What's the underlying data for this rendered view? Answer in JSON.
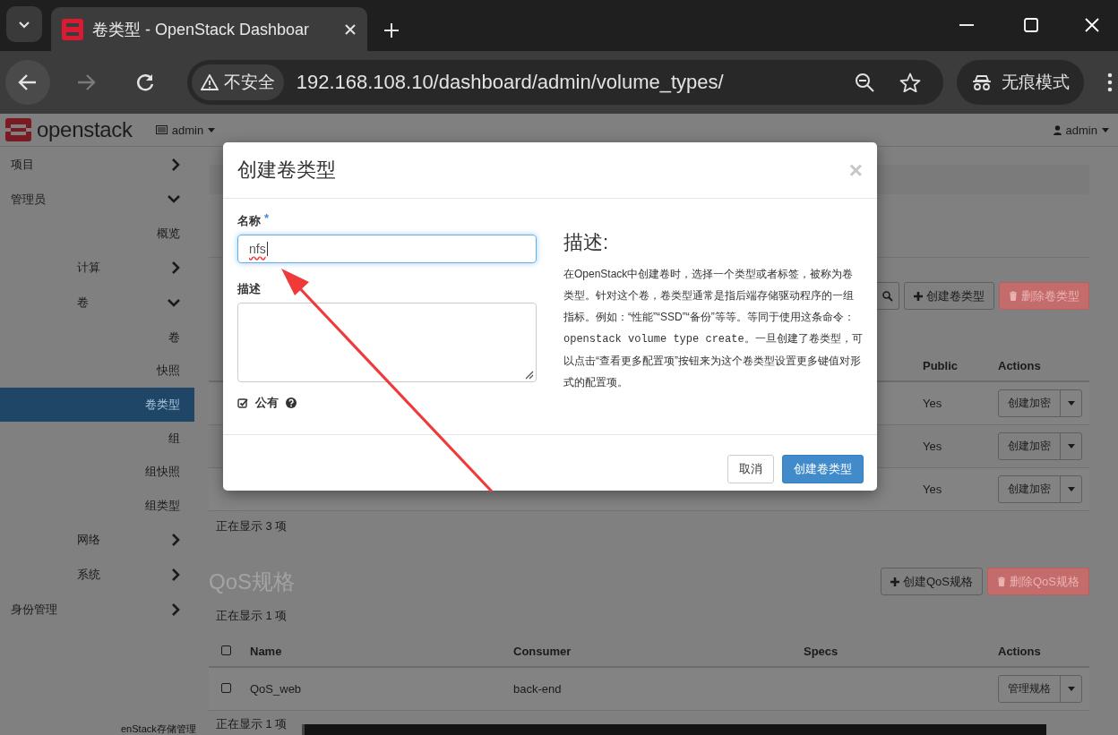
{
  "browser": {
    "tab_title": "卷类型 - OpenStack Dashboar",
    "security_label": "不安全",
    "url": "192.168.108.10/dashboard/admin/volume_types/",
    "incognito_label": "无痕模式"
  },
  "header": {
    "logo_text": "openstack",
    "project": "admin",
    "user": "admin"
  },
  "sidebar": {
    "items": [
      {
        "kind": "group",
        "label": "项目",
        "expanded": false
      },
      {
        "kind": "group",
        "label": "管理员",
        "expanded": true,
        "children": [
          {
            "kind": "link",
            "label": "概览",
            "selected": false
          },
          {
            "kind": "group",
            "label": "计算",
            "expanded": false
          },
          {
            "kind": "group",
            "label": "卷",
            "expanded": true,
            "children": [
              {
                "kind": "link",
                "label": "卷",
                "selected": false
              },
              {
                "kind": "link",
                "label": "快照",
                "selected": false
              },
              {
                "kind": "link",
                "label": "卷类型",
                "selected": true
              },
              {
                "kind": "link",
                "label": "组",
                "selected": false
              },
              {
                "kind": "link",
                "label": "组快照",
                "selected": false
              },
              {
                "kind": "link",
                "label": "组类型",
                "selected": false
              }
            ]
          },
          {
            "kind": "group",
            "label": "网络",
            "expanded": false
          },
          {
            "kind": "group",
            "label": "系统",
            "expanded": false
          }
        ]
      },
      {
        "kind": "group",
        "label": "身份管理",
        "expanded": false
      }
    ]
  },
  "volume_types": {
    "buttons": [
      {
        "label": "创建卷类型",
        "kind": "default"
      },
      {
        "label": "删除卷类型",
        "kind": "danger"
      }
    ],
    "columns": [
      "Public",
      "Actions"
    ],
    "rows": [
      {
        "public": "Yes",
        "action": "创建加密"
      },
      {
        "public": "Yes",
        "action": "创建加密"
      },
      {
        "public": "Yes",
        "action": "创建加密"
      }
    ],
    "footer": "正在显示 3 项"
  },
  "qos": {
    "heading": "QoS规格",
    "buttons": [
      {
        "label": "创建QoS规格",
        "kind": "default"
      },
      {
        "label": "删除QoS规格",
        "kind": "danger"
      }
    ],
    "count": "正在显示 1 项",
    "select_all_checked": false,
    "columns": [
      "Name",
      "Consumer",
      "Specs",
      "Actions"
    ],
    "rows": [
      {
        "checked": false,
        "name": "QoS_web",
        "consumer": "back-end",
        "action": "管理规格"
      }
    ],
    "footer": "正在显示 1 项"
  },
  "bottom_fragment": "enStack存储管理",
  "modal": {
    "title": "创建卷类型",
    "close": "×",
    "name_label": "名称",
    "required_mark": "*",
    "name_value": "nfs",
    "description_label": "描述",
    "public": {
      "label": "公有",
      "checked": true
    },
    "help_heading": "描述:",
    "help_text": [
      {
        "kind": "plain",
        "text": "在OpenStack中创建卷时，选择一个类型或者标签，被称为卷类型。针对这个卷，卷类型通常是指后端存储驱动程序的一组指标。例如：“性能”“SSD”“备份”等等。等同于使用这条命令："
      },
      {
        "kind": "code",
        "text": "openstack volume type create"
      },
      {
        "kind": "plain",
        "text": "。一旦创建了卷类型，可以点击“查看更多配置项”按钮来为这个卷类型设置更多键值对形式的配置项。"
      }
    ],
    "buttons": [
      {
        "label": "取消",
        "kind": "default"
      },
      {
        "label": "创建卷类型",
        "kind": "primary"
      }
    ]
  }
}
